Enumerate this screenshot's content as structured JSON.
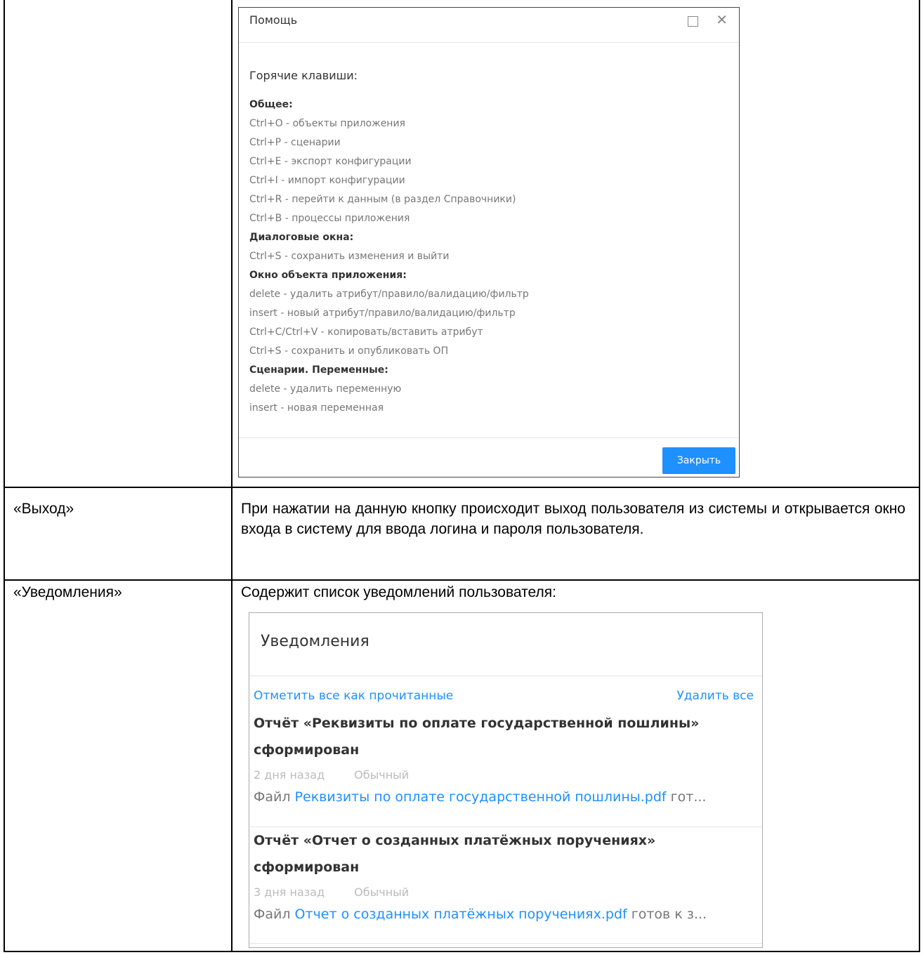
{
  "help_dialog": {
    "title": "Помощь",
    "heading": "Горячие клавиши:",
    "lines": [
      {
        "text": "Общее:",
        "section": true
      },
      {
        "text": "Ctrl+O - объекты приложения",
        "section": false
      },
      {
        "text": "Ctrl+P - сценарии",
        "section": false
      },
      {
        "text": "Ctrl+E - экспорт конфигурации",
        "section": false
      },
      {
        "text": "Ctrl+I - импорт конфигурации",
        "section": false
      },
      {
        "text": "Ctrl+R - перейти к данным (в раздел Справочники)",
        "section": false
      },
      {
        "text": "Ctrl+B - процессы приложения",
        "section": false
      },
      {
        "text": "Диалоговые окна:",
        "section": true
      },
      {
        "text": "Ctrl+S - сохранить изменения и выйти",
        "section": false
      },
      {
        "text": "Окно объекта приложения:",
        "section": true
      },
      {
        "text": "delete - удалить атрибут/правило/валидацию/фильтр",
        "section": false
      },
      {
        "text": "insert - новый атрибут/правило/валидацию/фильтр",
        "section": false
      },
      {
        "text": "Ctrl+C/Ctrl+V - копировать/вставить атрибут",
        "section": false
      },
      {
        "text": "Ctrl+S - сохранить и опубликовать ОП",
        "section": false
      },
      {
        "text": "Сценарии. Переменные:",
        "section": true
      },
      {
        "text": "delete - удалить переменную",
        "section": false
      },
      {
        "text": "insert - новая переменная",
        "section": false
      }
    ],
    "close_label": "Закрыть"
  },
  "rows": {
    "exit": {
      "name": "«Выход»",
      "description": "При нажатии на данную кнопку происходит выход пользователя из системы и открывается окно входа в систему для ввода логина и пароля пользователя."
    },
    "notifications": {
      "name": "«Уведомления»",
      "description": "Содержит список уведомлений пользователя:"
    }
  },
  "notifications_panel": {
    "title": "Уведомления",
    "mark_all_read": "Отметить все как прочитанные",
    "delete_all": "Удалить все",
    "items": [
      {
        "title": "Отчёт «Реквизиты по оплате государственной пошлины» сформирован",
        "time": "2 дня назад",
        "priority": "Обычный",
        "file_prefix": "Файл",
        "file_name": "Реквизиты по оплате государственной пошлины.pdf",
        "file_suffix": "гот..."
      },
      {
        "title": "Отчёт «Отчет о созданных платёжных поручениях» сформирован",
        "time": "3 дня назад",
        "priority": "Обычный",
        "file_prefix": "Файл",
        "file_name": "Отчет о созданных платёжных поручениях.pdf",
        "file_suffix": "готов к з..."
      }
    ]
  }
}
